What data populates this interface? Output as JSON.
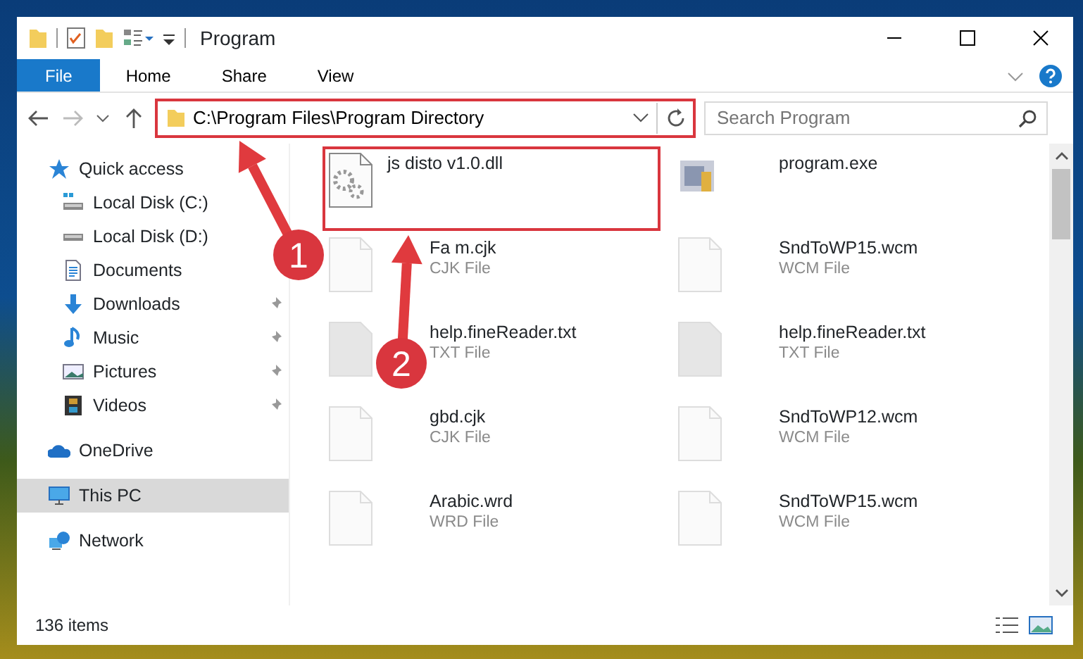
{
  "window": {
    "title": "Program"
  },
  "ribbon_tabs": [
    {
      "label": "File",
      "selected": true
    },
    {
      "label": "Home",
      "selected": false
    },
    {
      "label": "Share",
      "selected": false
    },
    {
      "label": "View",
      "selected": false
    }
  ],
  "address": {
    "path": "C:\\Program Files\\Program Directory",
    "highlighted": true
  },
  "search": {
    "placeholder": "Search Program"
  },
  "sidebar": {
    "items": [
      {
        "label": "Quick access",
        "selected": false,
        "children": [
          {
            "label": "Local Disk (C:)",
            "pinned": false,
            "selected": false
          },
          {
            "label": "Local Disk (D:)",
            "pinned": false,
            "selected": false
          },
          {
            "label": "Documents",
            "pinned": false,
            "selected": false
          },
          {
            "label": "Downloads",
            "pinned": true,
            "selected": false
          },
          {
            "label": "Music",
            "pinned": true,
            "selected": false
          },
          {
            "label": "Pictures",
            "pinned": true,
            "selected": false
          },
          {
            "label": "Videos",
            "pinned": true,
            "selected": false
          }
        ]
      },
      {
        "label": "OneDrive",
        "selected": false
      },
      {
        "label": "This PC",
        "selected": true
      },
      {
        "label": "Network",
        "selected": false
      }
    ]
  },
  "files": [
    {
      "name": "js disto v1.0.dll",
      "kind": "dll",
      "highlighted": true
    },
    {
      "name": "program.exe",
      "kind": "exe",
      "highlighted": false
    },
    {
      "name": "Fa m.cjk",
      "type": "CJK File",
      "kind": "doc",
      "highlighted": false
    },
    {
      "name": "SndToWP15.wcm",
      "type": "WCM File",
      "kind": "doc",
      "highlighted": false
    },
    {
      "name": "help.fineReader.txt",
      "type": "TXT File",
      "kind": "txt",
      "highlighted": false
    },
    {
      "name": "help.fineReader.txt",
      "type": "TXT File",
      "kind": "txt",
      "highlighted": false
    },
    {
      "name": "gbd.cjk",
      "type": "CJK File",
      "kind": "doc",
      "highlighted": false
    },
    {
      "name": "SndToWP12.wcm",
      "type": "WCM File",
      "kind": "doc",
      "highlighted": false
    },
    {
      "name": "Arabic.wrd",
      "type": "WRD File",
      "kind": "doc",
      "highlighted": false
    },
    {
      "name": "SndToWP15.wcm",
      "type": "WCM File",
      "kind": "doc",
      "highlighted": false
    }
  ],
  "annotations": [
    {
      "number": "1"
    },
    {
      "number": "2"
    }
  ],
  "status_bar": {
    "count": "136 items"
  }
}
